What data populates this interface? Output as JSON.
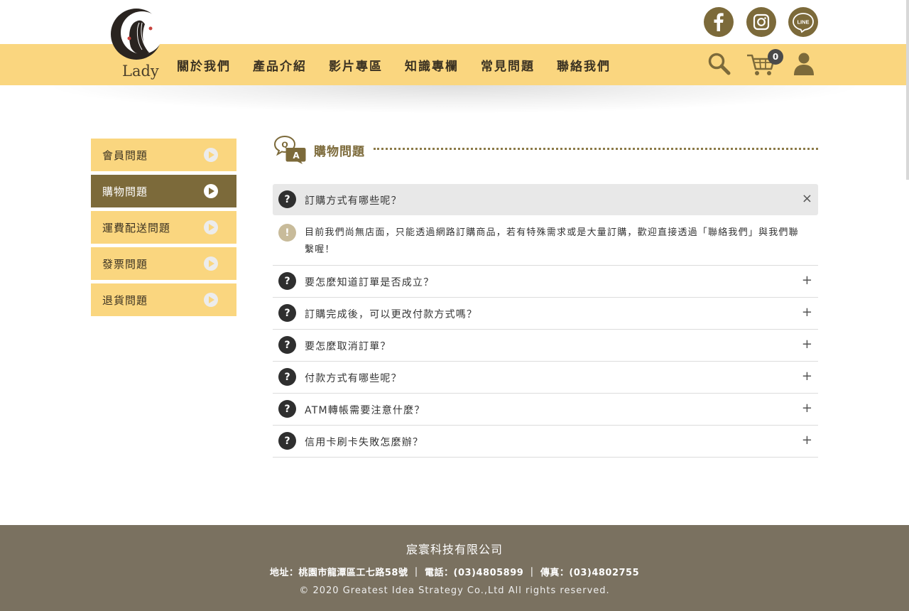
{
  "brand": {
    "logo_text": "Lady"
  },
  "nav": {
    "items": [
      "關於我們",
      "產品介紹",
      "影片專區",
      "知識專欄",
      "常見問題",
      "聯絡我們"
    ]
  },
  "social": {
    "icons": [
      "facebook-icon",
      "instagram-icon",
      "line-icon"
    ],
    "line_label": "LINE"
  },
  "cart": {
    "count": "0"
  },
  "colors": {
    "accent_yellow": "#fad67f",
    "accent_brown": "#7c6a3a",
    "footer_bg": "#7a7160"
  },
  "sidebar": {
    "items": [
      {
        "label": "會員問題",
        "active": false
      },
      {
        "label": "購物問題",
        "active": true
      },
      {
        "label": "運費配送問題",
        "active": false
      },
      {
        "label": "發票問題",
        "active": false
      },
      {
        "label": "退貨問題",
        "active": false
      }
    ]
  },
  "section": {
    "title": "購物問題",
    "icon_q": "Q",
    "icon_a": "A"
  },
  "faq": {
    "q_mark": "?",
    "a_mark": "!",
    "open_toggle": "×",
    "closed_toggle": "+",
    "open_question": "訂購方式有哪些呢？",
    "open_answer": "目前我們尚無店面，只能透過網路訂購商品，若有特殊需求或是大量訂購，歡迎直接透過「聯絡我們」與我們聯繫喔！",
    "questions": [
      "要怎麼知道訂單是否成立？",
      "訂購完成後，可以更改付款方式嗎？",
      "要怎麼取消訂單？",
      "付款方式有哪些呢？",
      "ATM轉帳需要注意什麼？",
      "信用卡刷卡失敗怎麼辦？"
    ]
  },
  "footer": {
    "company": "宸寰科技有限公司",
    "info": "地址：桃園市龍潭區工七路58號 ｜ 電話：(03)4805899 ｜ 傳真：(03)4802755",
    "copyright": "© 2020 Greatest Idea Strategy Co.,Ltd All rights reserved."
  }
}
